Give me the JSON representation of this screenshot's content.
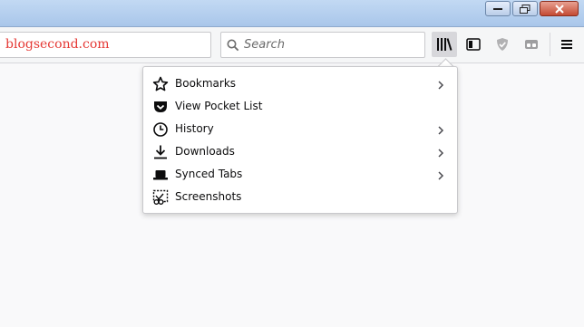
{
  "url": {
    "text": "blogsecond.com"
  },
  "search": {
    "placeholder": "Search"
  },
  "menu": {
    "items": [
      {
        "label": "Bookmarks",
        "icon": "star-icon",
        "submenu": true
      },
      {
        "label": "View Pocket List",
        "icon": "pocket-icon",
        "submenu": false
      },
      {
        "label": "History",
        "icon": "clock-icon",
        "submenu": true
      },
      {
        "label": "Downloads",
        "icon": "download-icon",
        "submenu": true
      },
      {
        "label": "Synced Tabs",
        "icon": "laptop-icon",
        "submenu": true
      },
      {
        "label": "Screenshots",
        "icon": "scissors-icon",
        "submenu": false
      }
    ]
  },
  "colors": {
    "url_text": "#e53935",
    "titlebar": "#b8d0ee",
    "toolbar": "#f5f6f7"
  }
}
